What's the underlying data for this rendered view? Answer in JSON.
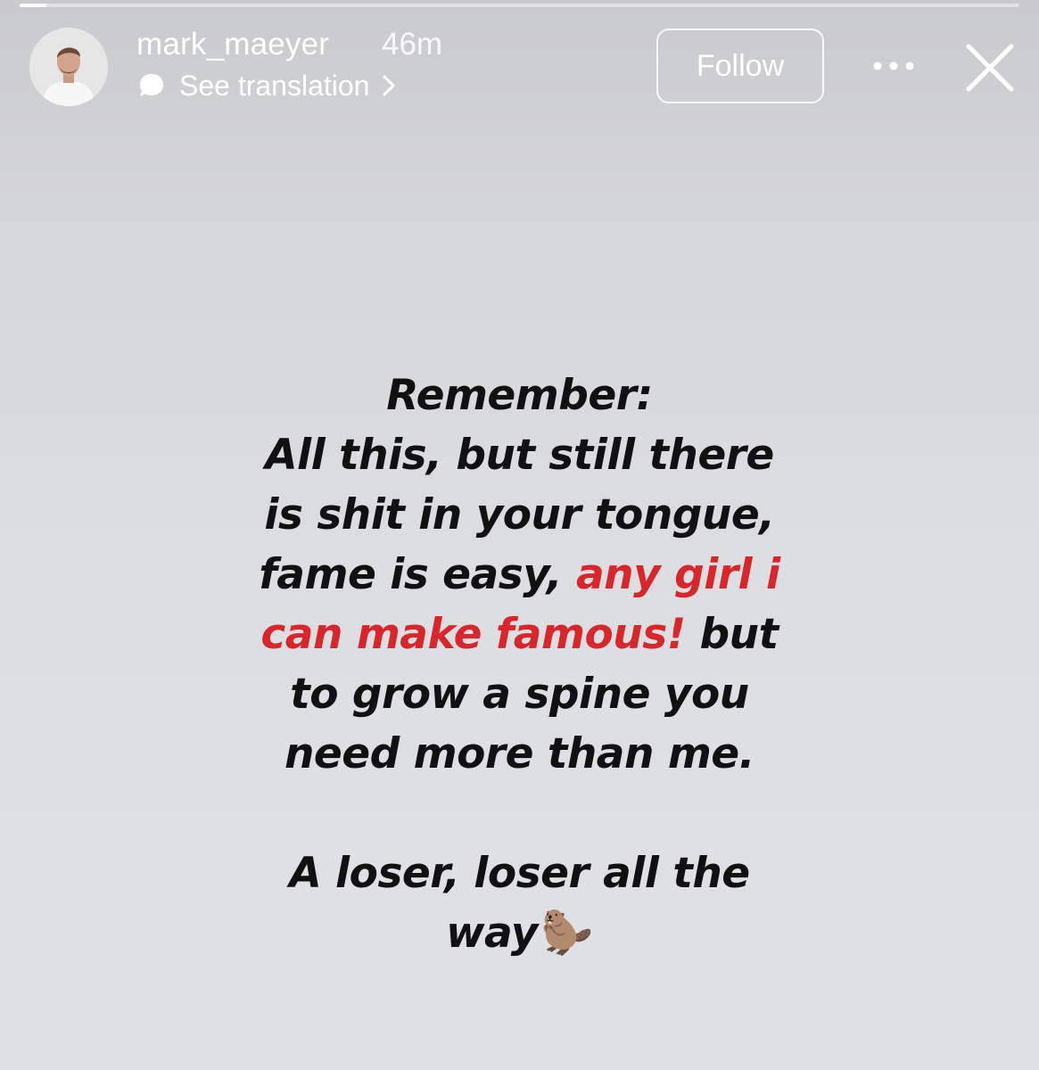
{
  "story": {
    "progress_fraction": 0.027,
    "username": "mark_maeyer",
    "time_ago": "46m",
    "see_translation": "See translation",
    "follow_label": "Follow",
    "text": {
      "line1": "Remember:",
      "line2": "All this, but still there",
      "line3": "is shit in your tongue,",
      "line4_black": "fame is easy, ",
      "line4_red": "any girl i",
      "line5_red": "can make famous!",
      "line5_black": " but",
      "line6": "to grow a spine you",
      "line7": "need more than me.",
      "line8": "A loser, loser all the",
      "line9": "way",
      "emoji": "🦫"
    }
  },
  "colors": {
    "highlight_red": "#d8262c",
    "text_black": "#111111",
    "background": "#dcdee2"
  },
  "icons": {
    "translation": "speech-bubble-icon",
    "chevron": "chevron-right-icon",
    "more": "more-icon",
    "close": "close-icon"
  }
}
